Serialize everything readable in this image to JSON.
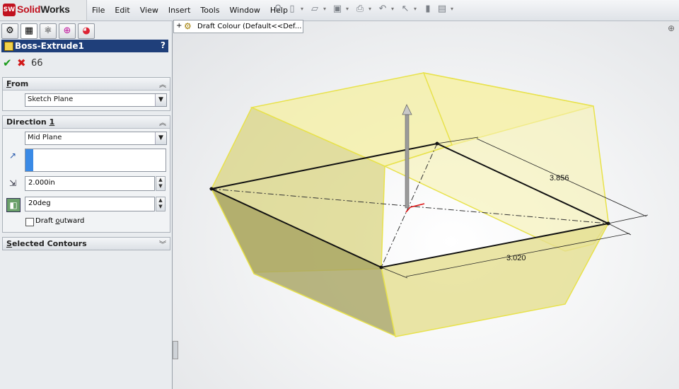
{
  "app": {
    "brand_solid": "Solid",
    "brand_works": "Works",
    "badge": "SW"
  },
  "menu": [
    "File",
    "Edit",
    "View",
    "Insert",
    "Tools",
    "Window",
    "Help"
  ],
  "toolbar_icons": [
    "pin-icon",
    "new-icon",
    "open-icon",
    "save-icon",
    "print-icon",
    "undo-icon",
    "select-icon",
    "rebuild-icon",
    "options-icon"
  ],
  "panel": {
    "tabs": [
      "feature-manager-icon",
      "property-manager-icon",
      "configuration-manager-icon",
      "dim-xpert-icon",
      "display-manager-icon"
    ],
    "feature_title": "Boss-Extrude1",
    "help": "?",
    "from": {
      "title": "From",
      "value": "Sketch Plane"
    },
    "direction1": {
      "title": "Direction 1",
      "end_condition": "Mid Plane",
      "depth": "2.000in",
      "draft_angle": "20deg",
      "draft_outward_label": "Draft outward",
      "draft_outward_checked": false
    },
    "selected_contours": {
      "title": "Selected Contours"
    }
  },
  "viewport": {
    "tree_item": "Draft Colour  (Default<<Def...",
    "dim_a": "3.856",
    "dim_b": "3.020"
  },
  "colors": {
    "title_bar": "#1f3f7a",
    "model_fill": "#f5f0a0",
    "model_edge": "#e6e04a"
  }
}
